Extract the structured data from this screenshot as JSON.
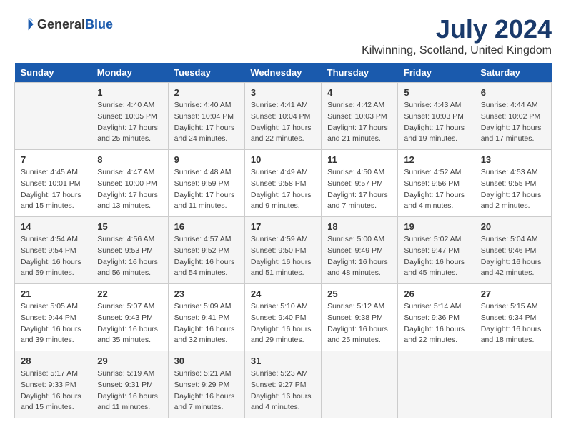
{
  "header": {
    "logo_general": "General",
    "logo_blue": "Blue",
    "month": "July 2024",
    "location": "Kilwinning, Scotland, United Kingdom"
  },
  "days_of_week": [
    "Sunday",
    "Monday",
    "Tuesday",
    "Wednesday",
    "Thursday",
    "Friday",
    "Saturday"
  ],
  "weeks": [
    [
      {
        "day": "",
        "info": ""
      },
      {
        "day": "1",
        "info": "Sunrise: 4:40 AM\nSunset: 10:05 PM\nDaylight: 17 hours\nand 25 minutes."
      },
      {
        "day": "2",
        "info": "Sunrise: 4:40 AM\nSunset: 10:04 PM\nDaylight: 17 hours\nand 24 minutes."
      },
      {
        "day": "3",
        "info": "Sunrise: 4:41 AM\nSunset: 10:04 PM\nDaylight: 17 hours\nand 22 minutes."
      },
      {
        "day": "4",
        "info": "Sunrise: 4:42 AM\nSunset: 10:03 PM\nDaylight: 17 hours\nand 21 minutes."
      },
      {
        "day": "5",
        "info": "Sunrise: 4:43 AM\nSunset: 10:03 PM\nDaylight: 17 hours\nand 19 minutes."
      },
      {
        "day": "6",
        "info": "Sunrise: 4:44 AM\nSunset: 10:02 PM\nDaylight: 17 hours\nand 17 minutes."
      }
    ],
    [
      {
        "day": "7",
        "info": "Sunrise: 4:45 AM\nSunset: 10:01 PM\nDaylight: 17 hours\nand 15 minutes."
      },
      {
        "day": "8",
        "info": "Sunrise: 4:47 AM\nSunset: 10:00 PM\nDaylight: 17 hours\nand 13 minutes."
      },
      {
        "day": "9",
        "info": "Sunrise: 4:48 AM\nSunset: 9:59 PM\nDaylight: 17 hours\nand 11 minutes."
      },
      {
        "day": "10",
        "info": "Sunrise: 4:49 AM\nSunset: 9:58 PM\nDaylight: 17 hours\nand 9 minutes."
      },
      {
        "day": "11",
        "info": "Sunrise: 4:50 AM\nSunset: 9:57 PM\nDaylight: 17 hours\nand 7 minutes."
      },
      {
        "day": "12",
        "info": "Sunrise: 4:52 AM\nSunset: 9:56 PM\nDaylight: 17 hours\nand 4 minutes."
      },
      {
        "day": "13",
        "info": "Sunrise: 4:53 AM\nSunset: 9:55 PM\nDaylight: 17 hours\nand 2 minutes."
      }
    ],
    [
      {
        "day": "14",
        "info": "Sunrise: 4:54 AM\nSunset: 9:54 PM\nDaylight: 16 hours\nand 59 minutes."
      },
      {
        "day": "15",
        "info": "Sunrise: 4:56 AM\nSunset: 9:53 PM\nDaylight: 16 hours\nand 56 minutes."
      },
      {
        "day": "16",
        "info": "Sunrise: 4:57 AM\nSunset: 9:52 PM\nDaylight: 16 hours\nand 54 minutes."
      },
      {
        "day": "17",
        "info": "Sunrise: 4:59 AM\nSunset: 9:50 PM\nDaylight: 16 hours\nand 51 minutes."
      },
      {
        "day": "18",
        "info": "Sunrise: 5:00 AM\nSunset: 9:49 PM\nDaylight: 16 hours\nand 48 minutes."
      },
      {
        "day": "19",
        "info": "Sunrise: 5:02 AM\nSunset: 9:47 PM\nDaylight: 16 hours\nand 45 minutes."
      },
      {
        "day": "20",
        "info": "Sunrise: 5:04 AM\nSunset: 9:46 PM\nDaylight: 16 hours\nand 42 minutes."
      }
    ],
    [
      {
        "day": "21",
        "info": "Sunrise: 5:05 AM\nSunset: 9:44 PM\nDaylight: 16 hours\nand 39 minutes."
      },
      {
        "day": "22",
        "info": "Sunrise: 5:07 AM\nSunset: 9:43 PM\nDaylight: 16 hours\nand 35 minutes."
      },
      {
        "day": "23",
        "info": "Sunrise: 5:09 AM\nSunset: 9:41 PM\nDaylight: 16 hours\nand 32 minutes."
      },
      {
        "day": "24",
        "info": "Sunrise: 5:10 AM\nSunset: 9:40 PM\nDaylight: 16 hours\nand 29 minutes."
      },
      {
        "day": "25",
        "info": "Sunrise: 5:12 AM\nSunset: 9:38 PM\nDaylight: 16 hours\nand 25 minutes."
      },
      {
        "day": "26",
        "info": "Sunrise: 5:14 AM\nSunset: 9:36 PM\nDaylight: 16 hours\nand 22 minutes."
      },
      {
        "day": "27",
        "info": "Sunrise: 5:15 AM\nSunset: 9:34 PM\nDaylight: 16 hours\nand 18 minutes."
      }
    ],
    [
      {
        "day": "28",
        "info": "Sunrise: 5:17 AM\nSunset: 9:33 PM\nDaylight: 16 hours\nand 15 minutes."
      },
      {
        "day": "29",
        "info": "Sunrise: 5:19 AM\nSunset: 9:31 PM\nDaylight: 16 hours\nand 11 minutes."
      },
      {
        "day": "30",
        "info": "Sunrise: 5:21 AM\nSunset: 9:29 PM\nDaylight: 16 hours\nand 7 minutes."
      },
      {
        "day": "31",
        "info": "Sunrise: 5:23 AM\nSunset: 9:27 PM\nDaylight: 16 hours\nand 4 minutes."
      },
      {
        "day": "",
        "info": ""
      },
      {
        "day": "",
        "info": ""
      },
      {
        "day": "",
        "info": ""
      }
    ]
  ]
}
